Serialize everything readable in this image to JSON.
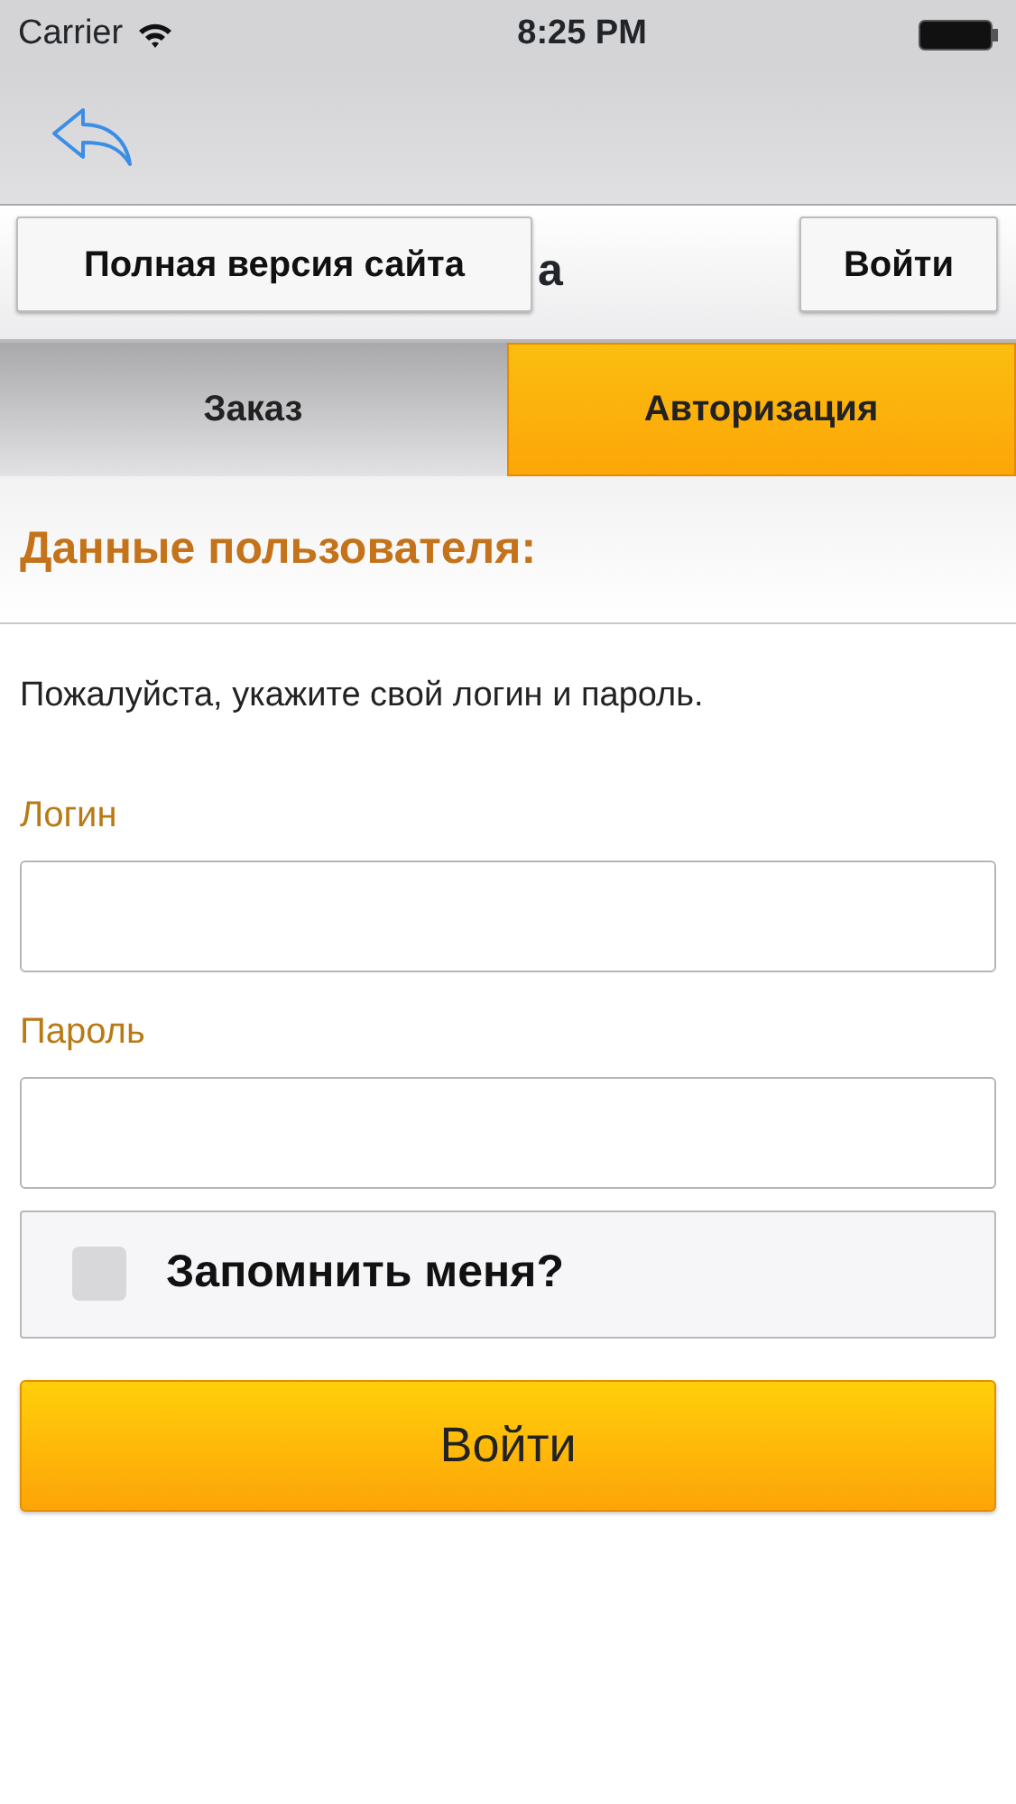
{
  "status_bar": {
    "carrier": "Carrier",
    "time": "8:25 PM"
  },
  "header": {
    "title_visible": "а",
    "full_site_button": "Полная версия сайта",
    "login_button": "Войти"
  },
  "tabs": [
    {
      "label": "Заказ",
      "selected": false
    },
    {
      "label": "Авторизация",
      "selected": true
    }
  ],
  "section": {
    "heading": "Данные пользователя:",
    "instruction": "Пожалуйста, укажите свой логин и пароль."
  },
  "fields": [
    {
      "label": "Логин"
    },
    {
      "label": "Пароль"
    }
  ],
  "remember": {
    "label": "Запомнить меня?",
    "checked": false
  },
  "submit_button": "Войти"
}
